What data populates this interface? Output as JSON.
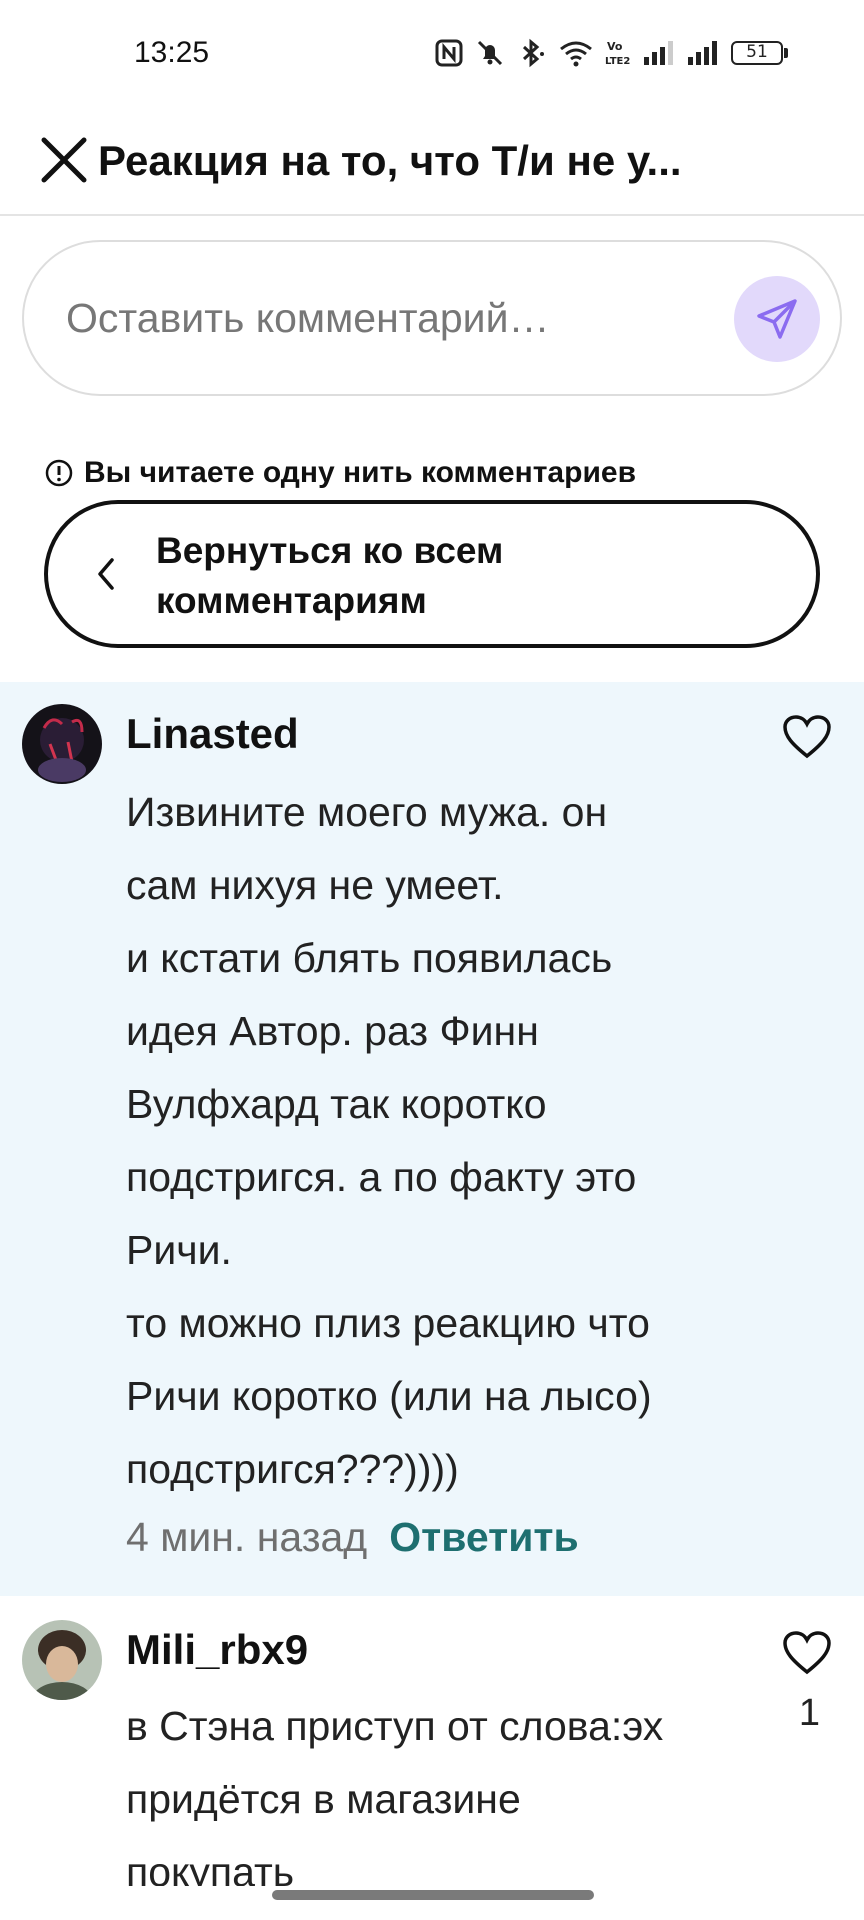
{
  "status_bar": {
    "time": "13:25",
    "battery": "51",
    "icons": [
      "nfc-icon",
      "mute-icon",
      "bluetooth-icon",
      "wifi-icon",
      "volte-icon",
      "signal-icon",
      "signal-icon",
      "battery-icon"
    ]
  },
  "header": {
    "title": "Реакция на то, что Т/и не у...",
    "close_icon": "close-icon"
  },
  "comment_input": {
    "placeholder": "Оставить комментарий…",
    "send_icon": "send-icon",
    "send_bg": "#e2d9fb",
    "send_color": "#8b6cf0"
  },
  "thread": {
    "notice": "Вы читаете одну нить комментариев",
    "back_label": "Вернуться ко всем комментариям"
  },
  "comments": [
    {
      "username": "Linasted",
      "lines": [
        "Извините моего мужа. он",
        "сам нихуя не умеет.",
        "и кстати блять появилась",
        "идея Автор. раз Финн",
        "Вулфхард так коротко",
        "подстригся. а по факту это",
        "Ричи.",
        "то можно плиз реакцию что",
        "Ричи коротко (или на лысо)",
        "подстригся???))))"
      ],
      "time": "4 мин. назад",
      "reply_label": "Ответить",
      "highlight_color": "#eef7fc"
    },
    {
      "username": "Mili_rbx9",
      "lines": [
        "в Стэна приступ от слова:эх",
        "придётся в магазине",
        "покупать"
      ],
      "likes": "1"
    }
  ],
  "colors": {
    "accent": "#1e6f70",
    "highlight": "#eef7fc"
  }
}
